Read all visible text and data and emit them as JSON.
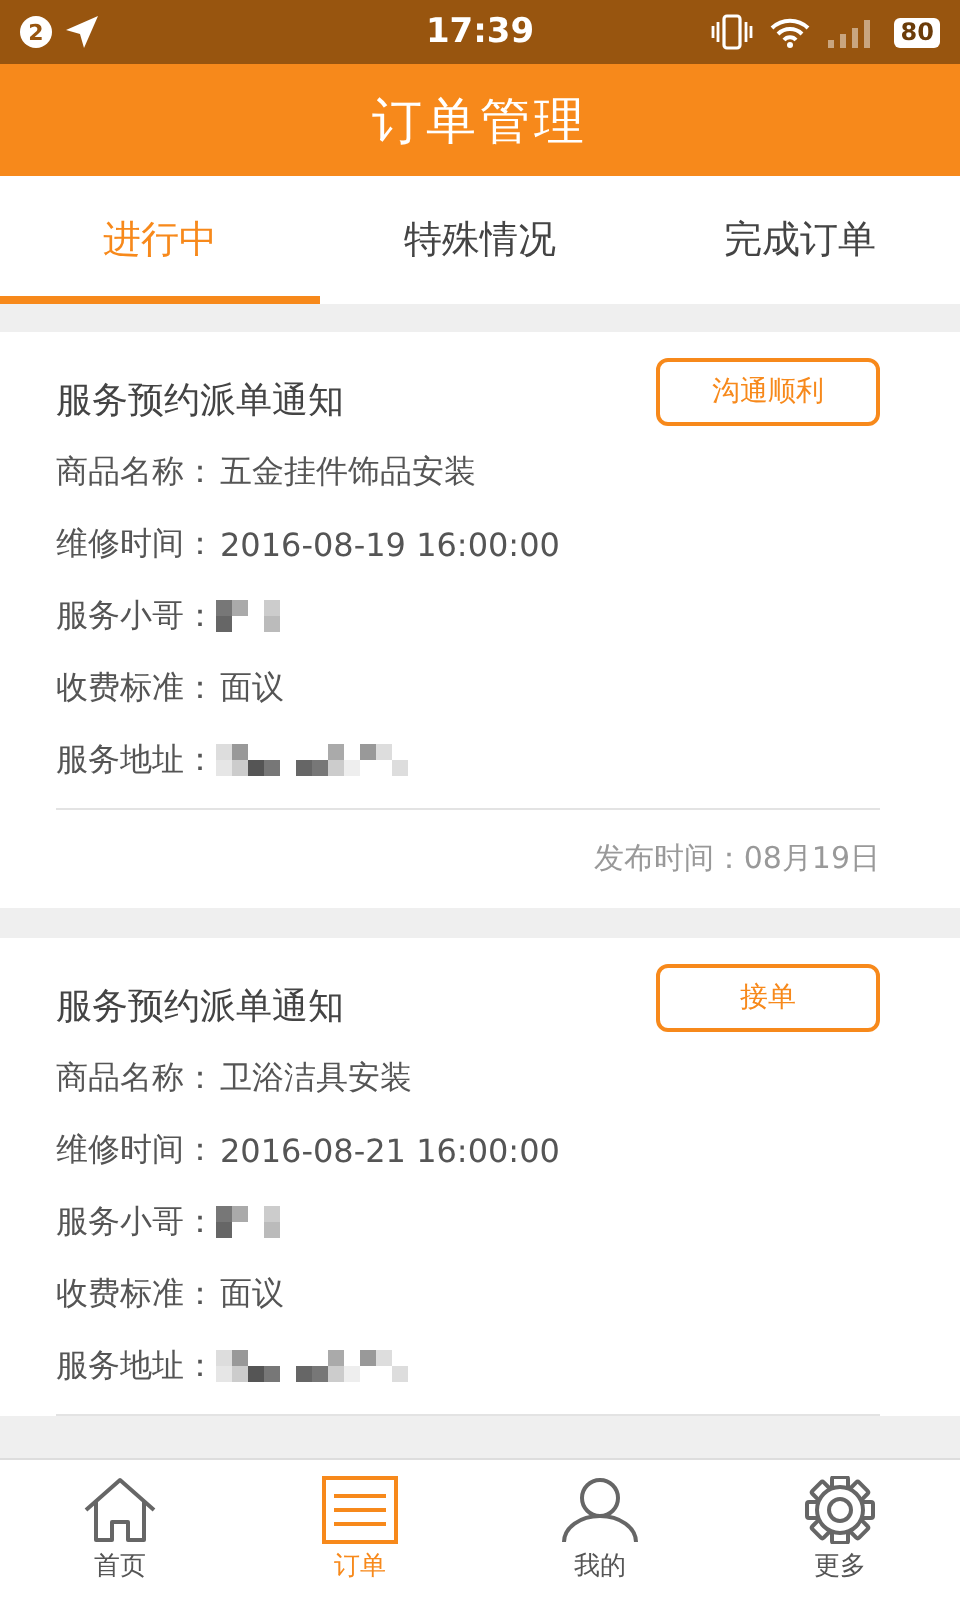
{
  "status_bar": {
    "notification_count": "2",
    "time": "17:39",
    "battery": "80"
  },
  "header": {
    "title": "订单管理"
  },
  "tabs": [
    {
      "label": "进行中",
      "selected": true
    },
    {
      "label": "特殊情况",
      "selected": false
    },
    {
      "label": "完成订单",
      "selected": false
    }
  ],
  "orders": [
    {
      "title": "服务预约派单通知",
      "action": "沟通顺利",
      "rows": [
        {
          "kind": "text",
          "label": "商品名称：",
          "value": "五金挂件饰品安装"
        },
        {
          "kind": "text",
          "label": "维修时间：",
          "value": "2016-08-19 16:00:00"
        },
        {
          "kind": "blurname",
          "label": "服务小哥："
        },
        {
          "kind": "text",
          "label": "收费标准：",
          "value": "面议"
        },
        {
          "kind": "bluraddress",
          "label": "服务地址："
        }
      ],
      "published": "发布时间：08月19日"
    },
    {
      "title": "服务预约派单通知",
      "action": "接单",
      "rows": [
        {
          "kind": "text",
          "label": "商品名称：",
          "value": "卫浴洁具安装"
        },
        {
          "kind": "text",
          "label": "维修时间：",
          "value": "2016-08-21 16:00:00"
        },
        {
          "kind": "blurname",
          "label": "服务小哥："
        },
        {
          "kind": "text",
          "label": "收费标准：",
          "value": "面议"
        },
        {
          "kind": "bluraddress",
          "label": "服务地址："
        }
      ]
    }
  ],
  "bottom_nav": [
    {
      "kind": "home",
      "label": "首页",
      "selected": false
    },
    {
      "kind": "list",
      "label": "订单",
      "selected": true
    },
    {
      "kind": "person",
      "label": "我的",
      "selected": false
    },
    {
      "kind": "gear",
      "label": "更多",
      "selected": false
    }
  ]
}
